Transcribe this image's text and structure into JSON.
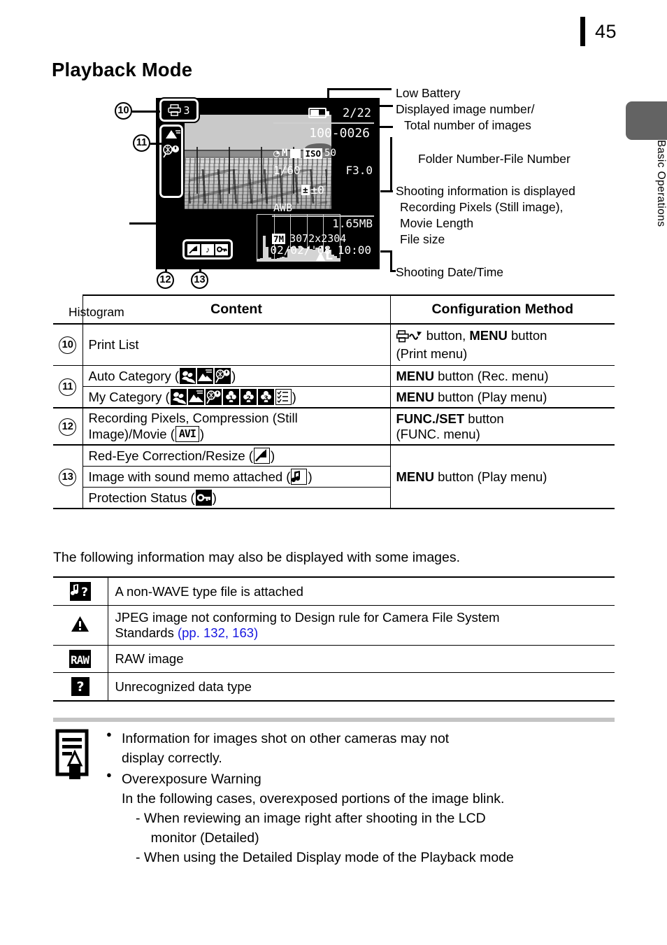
{
  "page": {
    "number": "45",
    "side_tab": "Basic Operations",
    "title": "Playback Mode"
  },
  "figure": {
    "lcd": {
      "print_count": "3",
      "image_counter": "2/22",
      "file_number": "100-0026",
      "date_time": "02/02/'08 10:00",
      "shooting_info": {
        "mode": "M",
        "iso_label": "ISO",
        "iso_value": "50",
        "shutter": "1/60",
        "aperture": "F3.0",
        "exposure_comp": "±0",
        "white_balance": "AWB",
        "file_size": "1.65MB",
        "resolution_badge": "7M",
        "resolution": "3072x2304"
      }
    },
    "callouts": {
      "c10": "10",
      "c11": "11",
      "c12": "12",
      "c13": "13"
    },
    "labels": {
      "histogram": "Histogram",
      "low_battery": "Low Battery",
      "displayed_image_number": "Displayed image number/",
      "total_number_of_images": "Total number of images",
      "folder_file_number": "Folder Number-File Number",
      "shooting_info_displayed": "Shooting information is displayed",
      "recording_pixels": "Recording Pixels (Still image),",
      "movie_length": "Movie Length",
      "file_size": "File size",
      "shooting_date_time": "Shooting Date/Time"
    }
  },
  "table1": {
    "headers": {
      "content": "Content",
      "configuration_method": "Configuration Method"
    },
    "rows": [
      {
        "num": "10",
        "content_pre": "Print List",
        "content_post": "",
        "icons": [],
        "config_pre": "",
        "config_icon": "print-share-icon",
        "config_mid": " button, ",
        "config_bold": "MENU",
        "config_post": " button",
        "config_line2": "(Print menu)"
      },
      {
        "num": "11",
        "content_pre": "Auto Category (",
        "content_post": ")",
        "icons": [
          "people-icon",
          "scenery-icon",
          "events-icon"
        ],
        "config_bold": "MENU",
        "config_post": " button (Rec. menu)"
      },
      {
        "num": "",
        "content_pre": "My Category (",
        "content_post": ")",
        "icons": [
          "people-icon",
          "scenery-icon",
          "events-icon",
          "category1-icon",
          "category2-icon",
          "category3-icon",
          "to-do-icon"
        ],
        "config_bold": "MENU",
        "config_post": " button (Play menu)"
      },
      {
        "num": "12",
        "content_pre": "Recording Pixels, Compression (Still",
        "content_line2_pre": "Image)/Movie (",
        "content_post": ")",
        "icons": [
          "avi-icon"
        ],
        "config_bold": "FUNC./SET",
        "config_post": " button",
        "config_line2": "(FUNC. menu)"
      },
      {
        "num": "13",
        "content_pre": "Red-Eye Correction/Resize (",
        "content_post": ")",
        "icons": [
          "red-eye-correction-icon"
        ],
        "config_bold": "MENU",
        "config_post": " button (Play menu)"
      },
      {
        "num": "",
        "content_pre": "Image with sound memo attached (",
        "content_post": ")",
        "icons": [
          "sound-memo-icon"
        ]
      },
      {
        "num": "",
        "content_pre": "Protection Status (",
        "content_post": ")",
        "icons": [
          "protect-key-icon"
        ]
      }
    ]
  },
  "intro_line": "The following information may also be displayed with some images.",
  "table2": {
    "rows": [
      {
        "icon": "non-wave-file-icon",
        "text": "A non-WAVE type file is attached"
      },
      {
        "icon": "warning-triangle-icon",
        "text": "JPEG image not conforming to Design rule for Camera File System",
        "text_line2": "Standards ",
        "link": "(pp. 132, 163)"
      },
      {
        "icon": "raw-image-icon",
        "text": "RAW image"
      },
      {
        "icon": "unknown-data-icon",
        "text": "Unrecognized data type"
      }
    ]
  },
  "note": {
    "icon": "memo-pencil-icon",
    "bullets": [
      {
        "line1": "Information for images shot on other cameras may not",
        "line2": "display correctly."
      },
      {
        "line1": "Overexposure Warning",
        "line2": "In the following cases, overexposed portions of the image blink.",
        "sub": [
          "-  When reviewing an image right after shooting in the LCD",
          "    monitor (Detailed)",
          "-  When using the Detailed Display mode of the Playback mode"
        ]
      }
    ]
  },
  "colors": {
    "link": "#1616e0",
    "side_tab": "#636363",
    "note_rule": "#c4c4c4"
  }
}
